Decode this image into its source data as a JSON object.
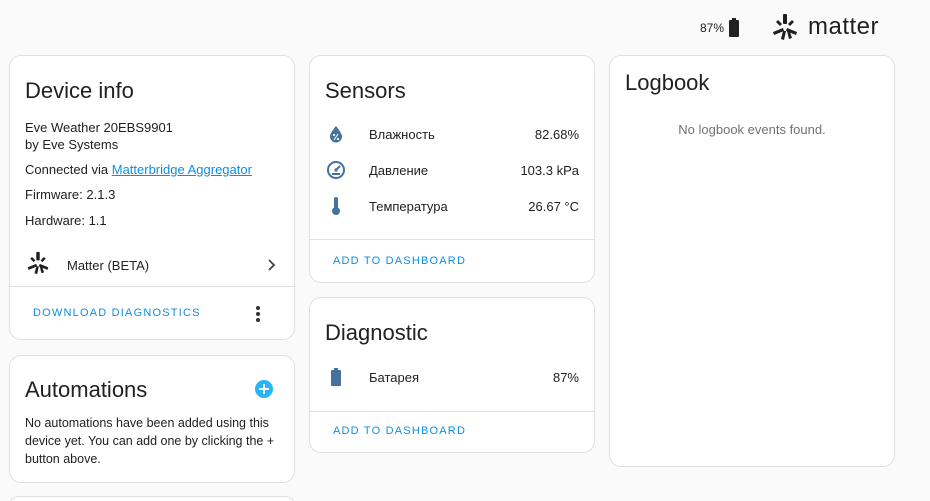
{
  "header": {
    "battery_percent": "87%",
    "brand_text": "matter"
  },
  "device_info": {
    "title": "Device info",
    "model": "Eve Weather 20EBS9901",
    "manufacturer": "by Eve Systems",
    "connected_prefix": "Connected via ",
    "connected_link": "Matterbridge Aggregator",
    "firmware": "Firmware: 2.1.3",
    "hardware": "Hardware: 1.1",
    "integration_label": "Matter (BETA)",
    "download_label": "DOWNLOAD DIAGNOSTICS"
  },
  "automations": {
    "title": "Automations",
    "empty_text": "No automations have been added using this device yet. You can add one by clicking the + button above."
  },
  "sensors": {
    "title": "Sensors",
    "rows": [
      {
        "name": "Влажность",
        "value": "82.68%",
        "icon": "water-percent-icon"
      },
      {
        "name": "Давление",
        "value": "103.3 kPa",
        "icon": "gauge-icon"
      },
      {
        "name": "Температура",
        "value": "26.67 °C",
        "icon": "thermometer-icon"
      }
    ],
    "add_label": "ADD TO DASHBOARD"
  },
  "diagnostic": {
    "title": "Diagnostic",
    "rows": [
      {
        "name": "Батарея",
        "value": "87%",
        "icon": "battery-icon"
      }
    ],
    "add_label": "ADD TO DASHBOARD"
  },
  "logbook": {
    "title": "Logbook",
    "empty_text": "No logbook events found."
  },
  "colors": {
    "accent": "#0d8ee0",
    "add_button": "#29b6f6",
    "icon": "#44739e"
  }
}
